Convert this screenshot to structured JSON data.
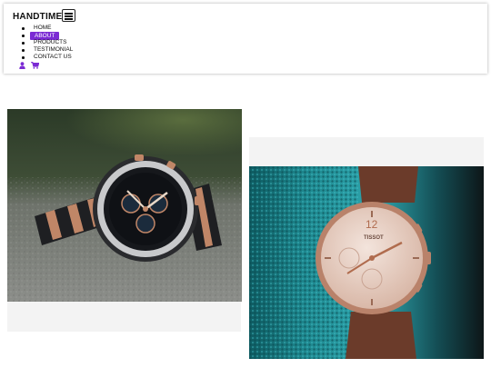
{
  "header": {
    "brand": "HANDTIME",
    "menu_toggle_icon": "hamburger-menu-icon",
    "nav": [
      {
        "label": "HOME",
        "active": false
      },
      {
        "label": "ABOUT",
        "active": true
      },
      {
        "label": "PRODUCTS",
        "active": false
      },
      {
        "label": "TESTIMONIAL",
        "active": false
      },
      {
        "label": "CONTACT US",
        "active": false
      }
    ],
    "icons": [
      "user-icon",
      "cart-icon"
    ],
    "accent_color": "#7b2bd4"
  },
  "products": [
    {
      "image": "chronograph-watch-black-rose-gold-on-stone"
    },
    {
      "image": "tissot-watch-rose-gold-on-teal-towel",
      "brand_text": "TISSOT"
    }
  ]
}
